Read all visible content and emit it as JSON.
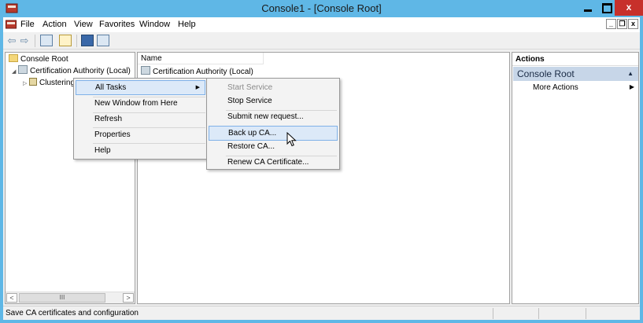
{
  "window": {
    "title": "Console1 - [Console Root]",
    "min_label": "",
    "max_label": "",
    "close_label": "x"
  },
  "menubar": {
    "items": [
      "File",
      "Action",
      "View",
      "Favorites",
      "Window",
      "Help"
    ],
    "mdi_min": "_",
    "mdi_restore": "❐",
    "mdi_close": "x"
  },
  "toolbar": {
    "back": "⇦",
    "forward": "⇨"
  },
  "tree": {
    "root": "Console Root",
    "ca": "Certification Authority (Local)",
    "child": "Clustering",
    "scroll_left": "<",
    "scroll_thumb": "III",
    "scroll_right": ">"
  },
  "center": {
    "column_header": "Name",
    "row": "Certification Authority (Local)"
  },
  "actions": {
    "header": "Actions",
    "section": "Console Root",
    "section_caret": "▲",
    "item": "More Actions",
    "item_arrow": "▶"
  },
  "context_menu": {
    "items": [
      "All Tasks",
      "New Window from Here",
      "Refresh",
      "Properties",
      "Help"
    ],
    "all_tasks_arrow": "▶"
  },
  "submenu": {
    "items": [
      "Start Service",
      "Stop Service",
      "Submit new request...",
      "Back up CA...",
      "Restore CA...",
      "Renew CA Certificate..."
    ]
  },
  "statusbar": {
    "text": "Save CA certificates and configuration"
  }
}
